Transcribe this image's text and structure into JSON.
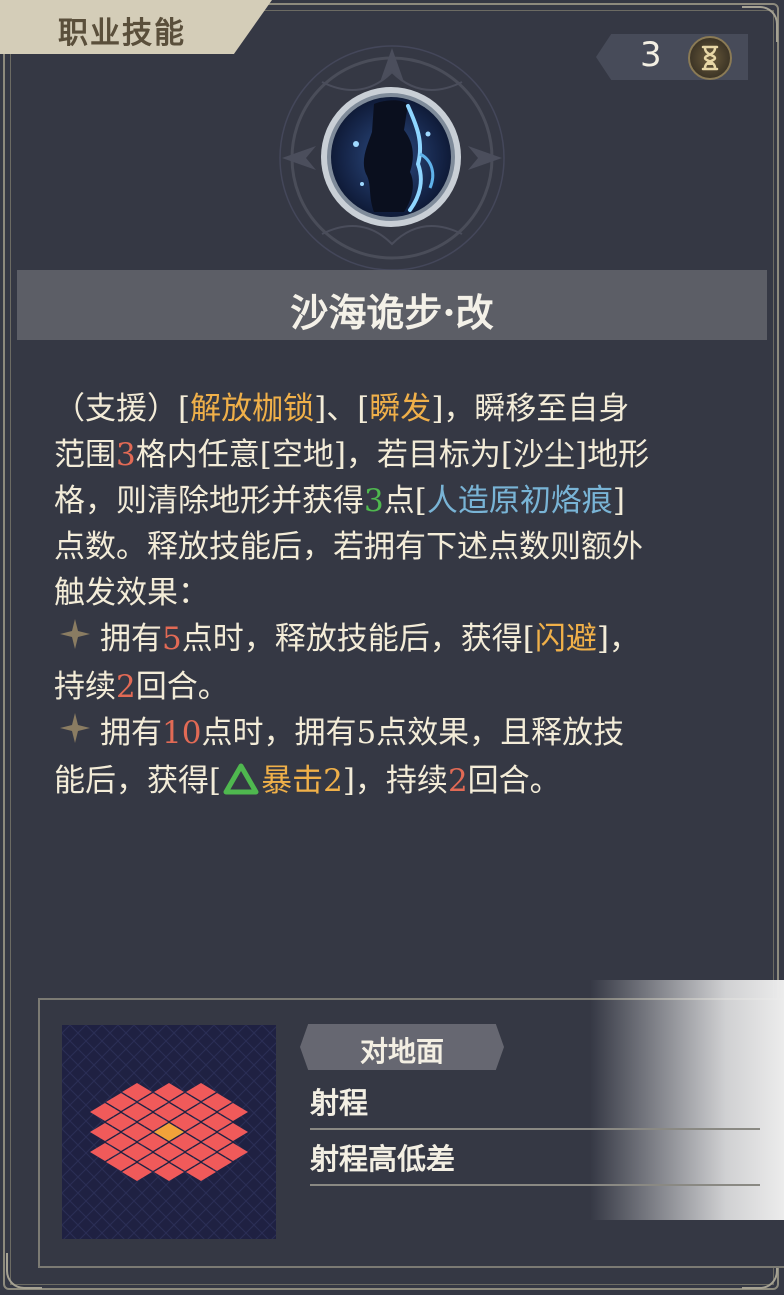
{
  "header": {
    "category": "职业技能",
    "cost": "3"
  },
  "skill": {
    "name": "沙海诡步·改"
  },
  "description": {
    "line1_a": "（支援）[",
    "kw_unshackle": "解放枷锁",
    "line1_b": "]、[",
    "kw_burst": "瞬发",
    "line1_c": "]，瞬移至自身",
    "line2_a": "范围",
    "range_num": "3",
    "line2_b": "格内任意[空地]，若目标为[沙尘]地形",
    "line3_a": "格，则清除地形并获得",
    "points_num": "3",
    "line3_b": "点[",
    "kw_points": "人造原初烙痕",
    "line3_c": "]",
    "line4": "点数。释放技能后，若拥有下述点数则额外",
    "line5": "触发效果：",
    "b1_a": "拥有",
    "b1_num": "5",
    "b1_b": "点时，释放技能后，获得[",
    "kw_dodge": "闪避",
    "b1_c": "]，",
    "b1_d": "持续",
    "b1_turns": "2",
    "b1_e": "回合。",
    "b2_a": "拥有",
    "b2_num": "10",
    "b2_b": "点时，拥有5点效果，且释放技",
    "b2_c": "能后，获得[",
    "kw_crit": "暴击2",
    "b2_d": "]，持续",
    "b2_turns": "2",
    "b2_e": "回合。"
  },
  "targeting": {
    "target_type": "对地面",
    "stats": [
      {
        "label": "射程"
      },
      {
        "label": "射程高低差"
      }
    ]
  },
  "colors": {
    "keyword": "#f0b049",
    "number": "#e26a55",
    "positive": "#4fb84f",
    "resource": "#79b4d6"
  },
  "icons": [
    "hourglass-icon",
    "skill-icon",
    "star-icon",
    "buff-up-icon"
  ]
}
